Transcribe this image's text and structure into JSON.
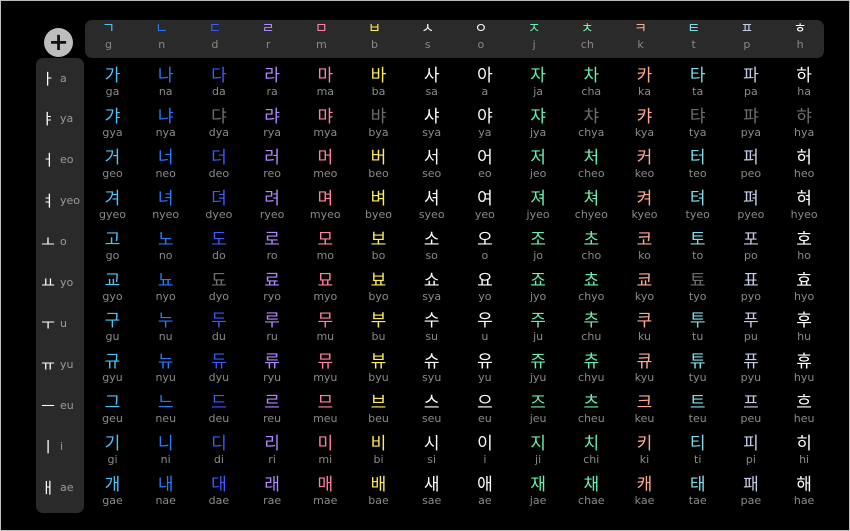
{
  "add_label": "+",
  "colors": [
    "#4fc3f7",
    "#2979ff",
    "#3d5afe",
    "#b388ff",
    "#ff80ab",
    "#ffee58",
    "#ffffff",
    "#ffffff",
    "#69f0ae",
    "#69f0ae",
    "#ffab91",
    "#80deea",
    "#c5cae9",
    "#ffffff"
  ],
  "dim_color": "#6e6e6e",
  "consonants": [
    {
      "jamo": "ㄱ",
      "rom": "g"
    },
    {
      "jamo": "ㄴ",
      "rom": "n"
    },
    {
      "jamo": "ㄷ",
      "rom": "d"
    },
    {
      "jamo": "ㄹ",
      "rom": "r"
    },
    {
      "jamo": "ㅁ",
      "rom": "m"
    },
    {
      "jamo": "ㅂ",
      "rom": "b"
    },
    {
      "jamo": "ㅅ",
      "rom": "s"
    },
    {
      "jamo": "ㅇ",
      "rom": "o"
    },
    {
      "jamo": "ㅈ",
      "rom": "j"
    },
    {
      "jamo": "ㅊ",
      "rom": "ch"
    },
    {
      "jamo": "ㅋ",
      "rom": "k"
    },
    {
      "jamo": "ㅌ",
      "rom": "t"
    },
    {
      "jamo": "ㅍ",
      "rom": "p"
    },
    {
      "jamo": "ㅎ",
      "rom": "h"
    }
  ],
  "vowels": [
    {
      "jamo": "ㅏ",
      "rom": "a"
    },
    {
      "jamo": "ㅑ",
      "rom": "ya"
    },
    {
      "jamo": "ㅓ",
      "rom": "eo"
    },
    {
      "jamo": "ㅕ",
      "rom": "yeo"
    },
    {
      "jamo": "ㅗ",
      "rom": "o"
    },
    {
      "jamo": "ㅛ",
      "rom": "yo"
    },
    {
      "jamo": "ㅜ",
      "rom": "u"
    },
    {
      "jamo": "ㅠ",
      "rom": "yu"
    },
    {
      "jamo": "ㅡ",
      "rom": "eu"
    },
    {
      "jamo": "ㅣ",
      "rom": "i"
    },
    {
      "jamo": "ㅐ",
      "rom": "ae"
    }
  ],
  "rows": [
    {
      "syl": [
        "가",
        "나",
        "다",
        "라",
        "마",
        "바",
        "사",
        "아",
        "자",
        "차",
        "카",
        "타",
        "파",
        "하"
      ],
      "rom": [
        "ga",
        "na",
        "da",
        "ra",
        "ma",
        "ba",
        "sa",
        "a",
        "ja",
        "cha",
        "ka",
        "ta",
        "pa",
        "ha"
      ],
      "dim": []
    },
    {
      "syl": [
        "갸",
        "냐",
        "댜",
        "랴",
        "먀",
        "뱌",
        "샤",
        "야",
        "쟈",
        "챠",
        "캬",
        "탸",
        "퍄",
        "햐"
      ],
      "rom": [
        "gya",
        "nya",
        "dya",
        "rya",
        "mya",
        "bya",
        "sya",
        "ya",
        "jya",
        "chya",
        "kya",
        "tya",
        "pya",
        "hya"
      ],
      "dim": [
        2,
        5,
        9,
        11,
        12,
        13
      ]
    },
    {
      "syl": [
        "거",
        "너",
        "더",
        "러",
        "머",
        "버",
        "서",
        "어",
        "저",
        "처",
        "커",
        "터",
        "퍼",
        "허"
      ],
      "rom": [
        "geo",
        "neo",
        "deo",
        "reo",
        "meo",
        "beo",
        "seo",
        "eo",
        "jeo",
        "cheo",
        "keo",
        "teo",
        "peo",
        "heo"
      ],
      "dim": []
    },
    {
      "syl": [
        "겨",
        "녀",
        "뎌",
        "려",
        "며",
        "벼",
        "셔",
        "여",
        "져",
        "쳐",
        "켜",
        "텨",
        "펴",
        "혀"
      ],
      "rom": [
        "gyeo",
        "nyeo",
        "dyeo",
        "ryeo",
        "myeo",
        "byeo",
        "syeo",
        "yeo",
        "jyeo",
        "chyeo",
        "kyeo",
        "tyeo",
        "pyeo",
        "hyeo"
      ],
      "dim": []
    },
    {
      "syl": [
        "고",
        "노",
        "도",
        "로",
        "모",
        "보",
        "소",
        "오",
        "조",
        "초",
        "코",
        "토",
        "포",
        "호"
      ],
      "rom": [
        "go",
        "no",
        "do",
        "ro",
        "mo",
        "bo",
        "so",
        "o",
        "jo",
        "cho",
        "ko",
        "to",
        "po",
        "ho"
      ],
      "dim": []
    },
    {
      "syl": [
        "교",
        "뇨",
        "됴",
        "료",
        "묘",
        "뵤",
        "쇼",
        "요",
        "죠",
        "쵸",
        "쿄",
        "툐",
        "표",
        "효"
      ],
      "rom": [
        "gyo",
        "nyo",
        "dyo",
        "ryo",
        "myo",
        "byo",
        "sya",
        "yo",
        "jyo",
        "chyo",
        "kyo",
        "tyo",
        "pyo",
        "hyo"
      ],
      "dim": [
        2,
        11
      ]
    },
    {
      "syl": [
        "구",
        "누",
        "두",
        "루",
        "무",
        "부",
        "수",
        "우",
        "주",
        "추",
        "쿠",
        "투",
        "푸",
        "후"
      ],
      "rom": [
        "gu",
        "nu",
        "du",
        "ru",
        "mu",
        "bu",
        "su",
        "u",
        "ju",
        "chu",
        "ku",
        "tu",
        "pu",
        "hu"
      ],
      "dim": []
    },
    {
      "syl": [
        "규",
        "뉴",
        "듀",
        "류",
        "뮤",
        "뷰",
        "슈",
        "유",
        "쥬",
        "츄",
        "큐",
        "튜",
        "퓨",
        "휴"
      ],
      "rom": [
        "gyu",
        "nyu",
        "dyu",
        "ryu",
        "myu",
        "byu",
        "syu",
        "yu",
        "jyu",
        "chyu",
        "kyu",
        "tyu",
        "pyu",
        "hyu"
      ],
      "dim": []
    },
    {
      "syl": [
        "그",
        "느",
        "드",
        "르",
        "므",
        "브",
        "스",
        "으",
        "즈",
        "츠",
        "크",
        "트",
        "프",
        "흐"
      ],
      "rom": [
        "geu",
        "neu",
        "deu",
        "reu",
        "meu",
        "beu",
        "seu",
        "eu",
        "jeu",
        "cheu",
        "keu",
        "teu",
        "peu",
        "heu"
      ],
      "dim": []
    },
    {
      "syl": [
        "기",
        "니",
        "디",
        "리",
        "미",
        "비",
        "시",
        "이",
        "지",
        "치",
        "키",
        "티",
        "피",
        "히"
      ],
      "rom": [
        "gi",
        "ni",
        "di",
        "ri",
        "mi",
        "bi",
        "si",
        "i",
        "ji",
        "chi",
        "ki",
        "ti",
        "pi",
        "hi"
      ],
      "dim": []
    },
    {
      "syl": [
        "개",
        "내",
        "대",
        "래",
        "매",
        "배",
        "새",
        "애",
        "재",
        "채",
        "캐",
        "태",
        "패",
        "해"
      ],
      "rom": [
        "gae",
        "nae",
        "dae",
        "rae",
        "mae",
        "bae",
        "sae",
        "ae",
        "jae",
        "chae",
        "kae",
        "tae",
        "pae",
        "hae"
      ],
      "dim": []
    }
  ]
}
